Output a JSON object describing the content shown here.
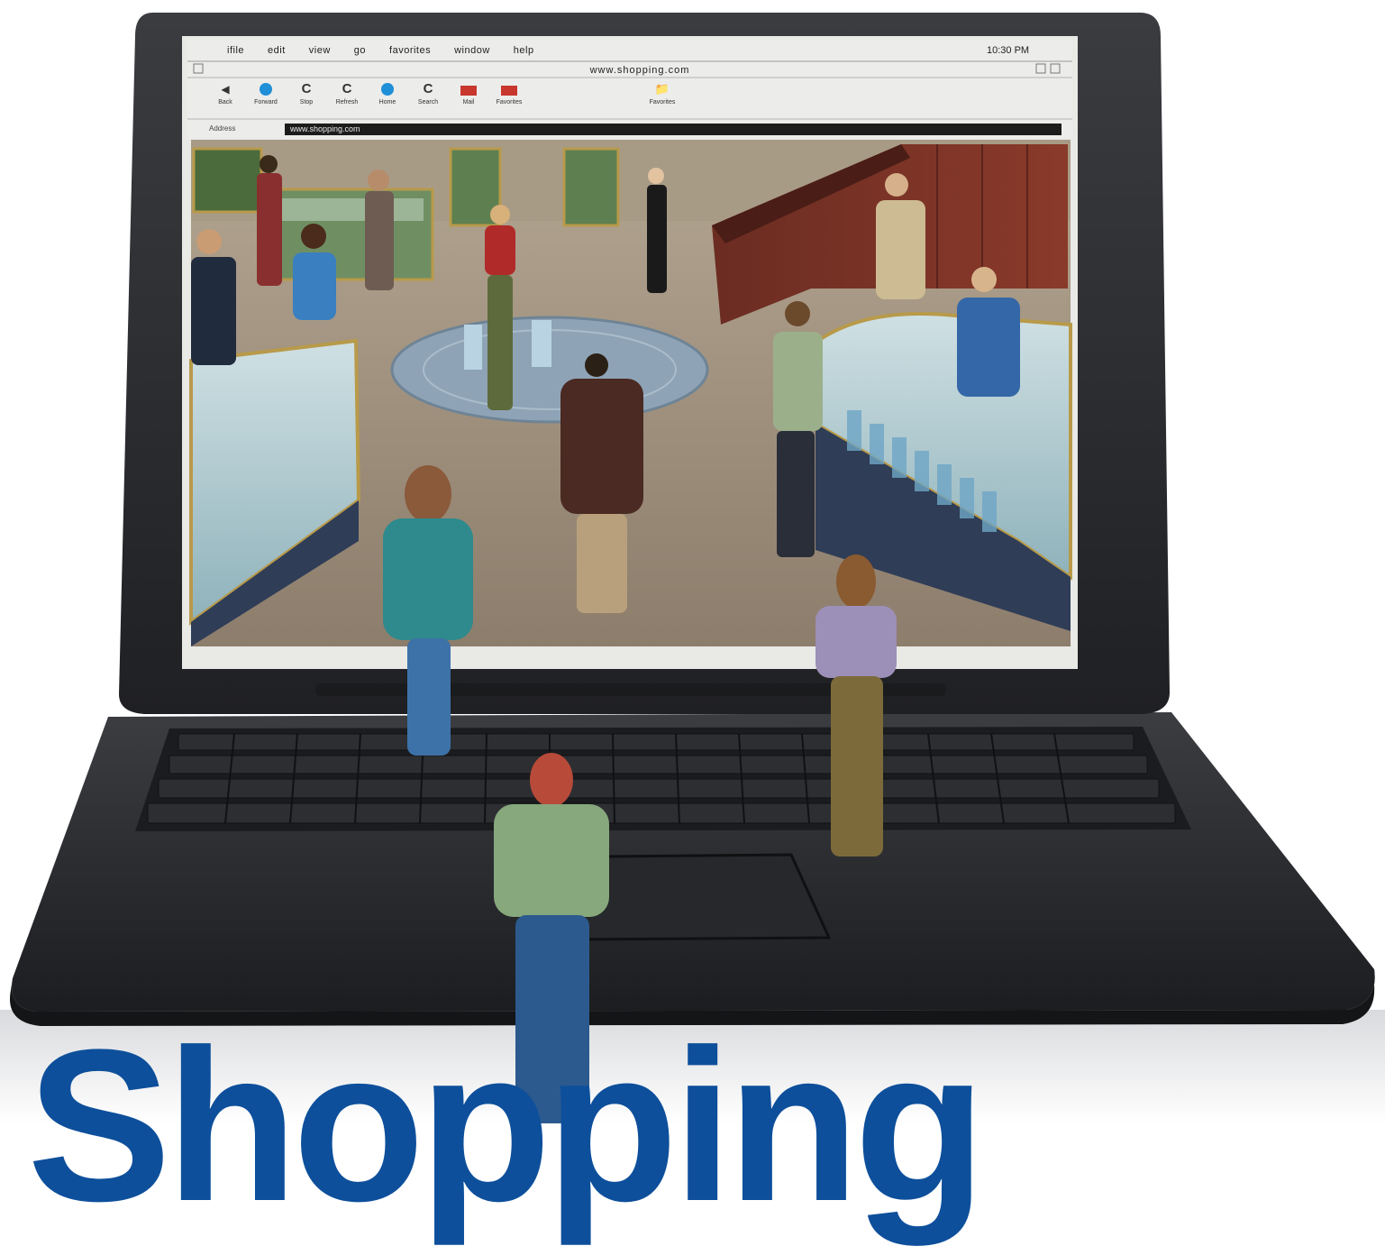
{
  "browser": {
    "menu_items": [
      "ifile",
      "edit",
      "view",
      "go",
      "favorites",
      "window",
      "help"
    ],
    "menu_clock": "10:30 PM",
    "window_title": "www.shopping.com",
    "toolbar": [
      {
        "label": "Back",
        "icon": "back-arrow-icon"
      },
      {
        "label": "Forward",
        "icon": "blue-dot-icon"
      },
      {
        "label": "Stop",
        "icon": "refresh-icon"
      },
      {
        "label": "Refresh",
        "icon": "refresh-icon"
      },
      {
        "label": "Home",
        "icon": "blue-dot-icon"
      },
      {
        "label": "Search",
        "icon": "refresh-icon"
      },
      {
        "label": "Mail",
        "icon": "red-square-icon"
      },
      {
        "label": "Favorites",
        "icon": "red-square-icon"
      }
    ],
    "folder_label": "Favorites",
    "address_label": "Address",
    "address_value": "www.shopping.com"
  },
  "headline": "Shopping",
  "colors": {
    "headline": "#0d4f9b",
    "laptop": "#2b2d30",
    "floor": "#b9a48c",
    "rotunda": "#8fa3b6"
  }
}
